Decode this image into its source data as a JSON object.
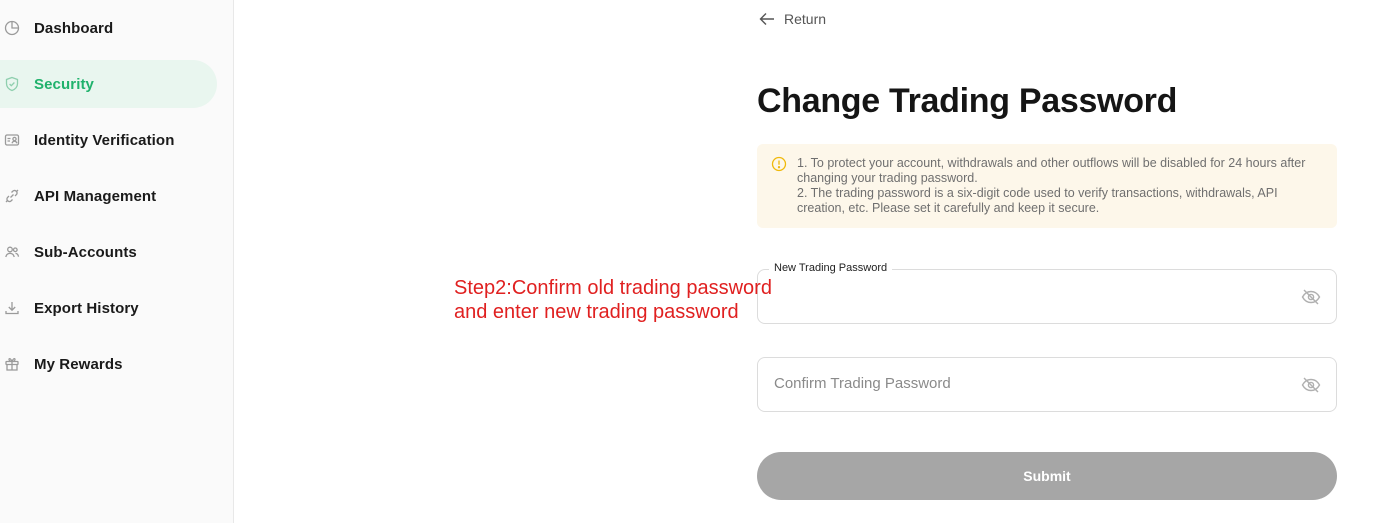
{
  "sidebar": {
    "items": [
      {
        "label": "Dashboard",
        "icon": "pie-chart-icon"
      },
      {
        "label": "Security",
        "icon": "shield-icon"
      },
      {
        "label": "Identity Verification",
        "icon": "id-card-icon"
      },
      {
        "label": "API Management",
        "icon": "api-link-icon"
      },
      {
        "label": "Sub-Accounts",
        "icon": "users-icon"
      },
      {
        "label": "Export History",
        "icon": "download-icon"
      },
      {
        "label": "My Rewards",
        "icon": "gift-icon"
      }
    ],
    "active": "Security"
  },
  "main": {
    "return_label": "Return",
    "title": "Change Trading Password",
    "notice": {
      "line1": "1. To protect your account, withdrawals and other outflows will be disabled for 24 hours after changing your trading password.",
      "line2": "2. The trading password is a six-digit code used to verify transactions, withdrawals, API creation, etc. Please set it carefully and keep it secure."
    },
    "new_password": {
      "label": "New Trading Password",
      "value": ""
    },
    "confirm_password": {
      "placeholder": "Confirm Trading Password",
      "value": ""
    },
    "submit_label": "Submit"
  },
  "annotation": {
    "line1": "Step2:Confirm old trading password",
    "line2": "and enter new trading password"
  },
  "colors": {
    "accent": "#20b26c",
    "active_bg": "#e9f6ef",
    "notice_bg": "#fdf7ea",
    "warning": "#f0b90b",
    "submit_disabled": "#a6a6a6",
    "annotation": "#e02020"
  }
}
